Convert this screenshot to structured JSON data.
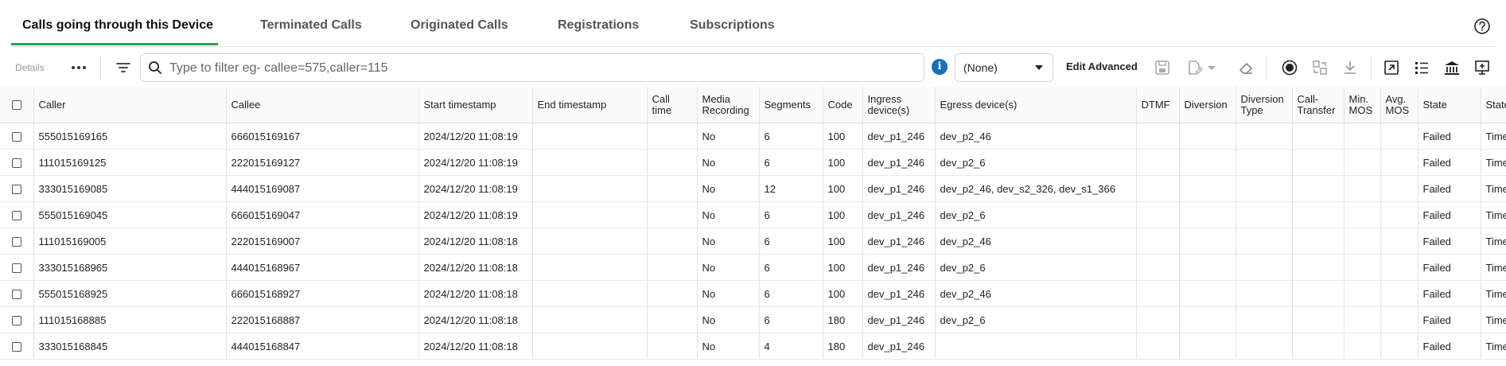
{
  "tabs": [
    {
      "label": "Calls going through this Device",
      "active": true
    },
    {
      "label": "Terminated Calls"
    },
    {
      "label": "Originated Calls"
    },
    {
      "label": "Registrations"
    },
    {
      "label": "Subscriptions"
    }
  ],
  "toolbar": {
    "details_label": "Details",
    "search_placeholder": "Type to filter eg- callee=575,caller=115",
    "search_value": "",
    "select_value": "(None)",
    "edit_advanced_label": "Edit Advanced"
  },
  "icons": {
    "help": "question-circle-icon",
    "more": "more-horizontal-icon",
    "filter": "filter-icon",
    "search": "search-icon",
    "info": "info-icon",
    "save": "save-icon",
    "edit_doc": "edit-document-icon",
    "eraser": "eraser-icon",
    "record": "record-icon",
    "swap": "swap-icon",
    "download": "download-icon",
    "open_external": "open-external-icon",
    "list": "list-icon",
    "bank": "bank-icon",
    "presentation": "presentation-icon"
  },
  "colors": {
    "accent": "#2f9e58",
    "info": "#1a6fb5"
  },
  "table": {
    "columns": [
      {
        "key": "caller",
        "label": "Caller"
      },
      {
        "key": "callee",
        "label": "Callee"
      },
      {
        "key": "start",
        "label": "Start timestamp"
      },
      {
        "key": "end",
        "label": "End timestamp"
      },
      {
        "key": "call_time",
        "label": "Call time"
      },
      {
        "key": "media",
        "label": "Media Recording"
      },
      {
        "key": "segments",
        "label": "Segments"
      },
      {
        "key": "code",
        "label": "Code"
      },
      {
        "key": "ingress",
        "label": "Ingress device(s)"
      },
      {
        "key": "egress",
        "label": "Egress device(s)"
      },
      {
        "key": "dtmf",
        "label": "DTMF"
      },
      {
        "key": "diversion",
        "label": "Diversion"
      },
      {
        "key": "diversion_type",
        "label": "Diversion Type"
      },
      {
        "key": "call_transfer",
        "label": "Call-Transfer"
      },
      {
        "key": "min_mos",
        "label": "Min. MOS"
      },
      {
        "key": "avg_mos",
        "label": "Avg. MOS"
      },
      {
        "key": "state",
        "label": "State"
      },
      {
        "key": "state2",
        "label": "State"
      }
    ],
    "rows": [
      {
        "caller": "555015169165",
        "callee": "666015169167",
        "start": "2024/12/20 11:08:19",
        "end": "",
        "call_time": "",
        "media": "No",
        "segments": "6",
        "code": "100",
        "ingress": "dev_p1_246",
        "egress": "dev_p2_46",
        "dtmf": "",
        "diversion": "",
        "diversion_type": "",
        "call_transfer": "",
        "min_mos": "",
        "avg_mos": "",
        "state": "Failed",
        "state2": "Timed"
      },
      {
        "caller": "111015169125",
        "callee": "222015169127",
        "start": "2024/12/20 11:08:19",
        "end": "",
        "call_time": "",
        "media": "No",
        "segments": "6",
        "code": "100",
        "ingress": "dev_p1_246",
        "egress": "dev_p2_6",
        "dtmf": "",
        "diversion": "",
        "diversion_type": "",
        "call_transfer": "",
        "min_mos": "",
        "avg_mos": "",
        "state": "Failed",
        "state2": "Timed"
      },
      {
        "caller": "333015169085",
        "callee": "444015169087",
        "start": "2024/12/20 11:08:19",
        "end": "",
        "call_time": "",
        "media": "No",
        "segments": "12",
        "code": "100",
        "ingress": "dev_p1_246",
        "egress": "dev_p2_46, dev_s2_326, dev_s1_366",
        "dtmf": "",
        "diversion": "",
        "diversion_type": "",
        "call_transfer": "",
        "min_mos": "",
        "avg_mos": "",
        "state": "Failed",
        "state2": "Timed"
      },
      {
        "caller": "555015169045",
        "callee": "666015169047",
        "start": "2024/12/20 11:08:19",
        "end": "",
        "call_time": "",
        "media": "No",
        "segments": "6",
        "code": "100",
        "ingress": "dev_p1_246",
        "egress": "dev_p2_6",
        "dtmf": "",
        "diversion": "",
        "diversion_type": "",
        "call_transfer": "",
        "min_mos": "",
        "avg_mos": "",
        "state": "Failed",
        "state2": "Timed"
      },
      {
        "caller": "111015169005",
        "callee": "222015169007",
        "start": "2024/12/20 11:08:18",
        "end": "",
        "call_time": "",
        "media": "No",
        "segments": "6",
        "code": "100",
        "ingress": "dev_p1_246",
        "egress": "dev_p2_46",
        "dtmf": "",
        "diversion": "",
        "diversion_type": "",
        "call_transfer": "",
        "min_mos": "",
        "avg_mos": "",
        "state": "Failed",
        "state2": "Timed"
      },
      {
        "caller": "333015168965",
        "callee": "444015168967",
        "start": "2024/12/20 11:08:18",
        "end": "",
        "call_time": "",
        "media": "No",
        "segments": "6",
        "code": "100",
        "ingress": "dev_p1_246",
        "egress": "dev_p2_6",
        "dtmf": "",
        "diversion": "",
        "diversion_type": "",
        "call_transfer": "",
        "min_mos": "",
        "avg_mos": "",
        "state": "Failed",
        "state2": "Timed"
      },
      {
        "caller": "555015168925",
        "callee": "666015168927",
        "start": "2024/12/20 11:08:18",
        "end": "",
        "call_time": "",
        "media": "No",
        "segments": "6",
        "code": "100",
        "ingress": "dev_p1_246",
        "egress": "dev_p2_46",
        "dtmf": "",
        "diversion": "",
        "diversion_type": "",
        "call_transfer": "",
        "min_mos": "",
        "avg_mos": "",
        "state": "Failed",
        "state2": "Timed"
      },
      {
        "caller": "111015168885",
        "callee": "222015168887",
        "start": "2024/12/20 11:08:18",
        "end": "",
        "call_time": "",
        "media": "No",
        "segments": "6",
        "code": "180",
        "ingress": "dev_p1_246",
        "egress": "dev_p2_6",
        "dtmf": "",
        "diversion": "",
        "diversion_type": "",
        "call_transfer": "",
        "min_mos": "",
        "avg_mos": "",
        "state": "Failed",
        "state2": "Timed"
      },
      {
        "caller": "333015168845",
        "callee": "444015168847",
        "start": "2024/12/20 11:08:18",
        "end": "",
        "call_time": "",
        "media": "No",
        "segments": "4",
        "code": "180",
        "ingress": "dev_p1_246",
        "egress": "",
        "dtmf": "",
        "diversion": "",
        "diversion_type": "",
        "call_transfer": "",
        "min_mos": "",
        "avg_mos": "",
        "state": "Failed",
        "state2": "Timed"
      }
    ]
  }
}
